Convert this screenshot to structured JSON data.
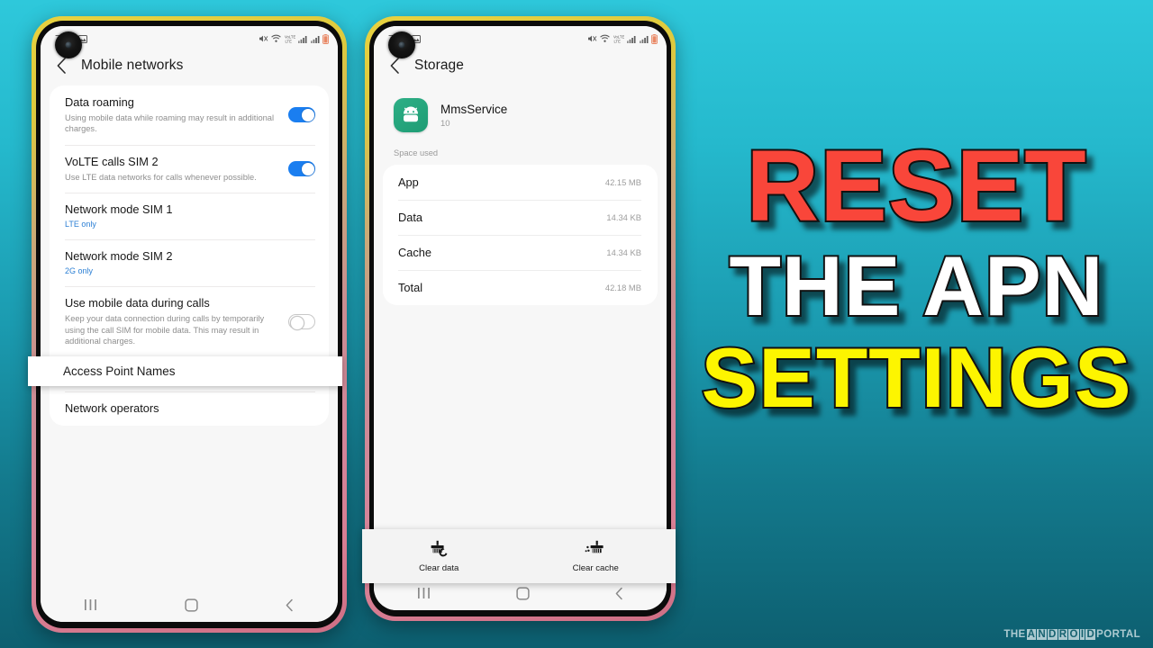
{
  "background": {
    "top_color": "#2ec8db",
    "bottom_color": "#0d5f70"
  },
  "phone_left": {
    "status_bar": {
      "time": "7:20",
      "icons": [
        "image-icon",
        "mute-icon",
        "wifi-icon",
        "volte-icon",
        "signal-bars-icon",
        "signal-bars-icon",
        "battery-icon"
      ]
    },
    "app_bar": {
      "title": "Mobile networks",
      "back_label": "back-chevron"
    },
    "rows": [
      {
        "title": "Data roaming",
        "sub": "Using mobile data while roaming may result in additional charges.",
        "control": "toggle",
        "state": "on"
      },
      {
        "title": "VoLTE calls SIM 2",
        "sub": "Use LTE data networks for calls whenever possible.",
        "control": "toggle",
        "state": "on"
      },
      {
        "title": "Network mode SIM 1",
        "sub": "LTE only",
        "sub_style": "blue",
        "control": "none"
      },
      {
        "title": "Network mode SIM 2",
        "sub": "2G only",
        "sub_style": "blue",
        "control": "none"
      },
      {
        "title": "Use mobile data during calls",
        "sub": "Keep your data connection during calls by temporarily using the call SIM for mobile data. This may result in additional charges.",
        "control": "toggle",
        "state": "off"
      },
      {
        "title": "Access Point Names",
        "sub": "",
        "control": "none"
      },
      {
        "title": "Network operators",
        "sub": "",
        "control": "none"
      }
    ],
    "highlight": {
      "label": "Access Point Names"
    },
    "nav_bar": {
      "recents": "recents-icon",
      "home": "home-icon",
      "back": "back-icon"
    }
  },
  "phone_right": {
    "status_bar": {
      "time": "7:18"
    },
    "app_bar": {
      "title": "Storage"
    },
    "app": {
      "name": "MmsService",
      "version": "10",
      "icon": "android-robot-icon"
    },
    "section_label": "Space used",
    "usage_rows": [
      {
        "key": "App",
        "value": "42.15 MB"
      },
      {
        "key": "Data",
        "value": "14.34 KB"
      },
      {
        "key": "Cache",
        "value": "14.34 KB"
      },
      {
        "key": "Total",
        "value": "42.18 MB"
      }
    ],
    "action_bar": [
      {
        "label": "Clear data",
        "icon": "clear-data-brush-icon"
      },
      {
        "label": "Clear cache",
        "icon": "clear-cache-brush-icon"
      }
    ],
    "nav_bar": {
      "recents": "recents-icon",
      "home": "home-icon",
      "back": "back-icon"
    }
  },
  "headline": {
    "line1": "RESET",
    "line2": "THE APN",
    "line3": "SETTINGS",
    "line1_color": "#f9463a",
    "line2_color": "#ffffff",
    "line3_color": "#fdf500",
    "outline_color": "#111111"
  },
  "watermark": {
    "prefix": "THE",
    "boxed": "ANDROID",
    "suffix": "PORTAL"
  }
}
